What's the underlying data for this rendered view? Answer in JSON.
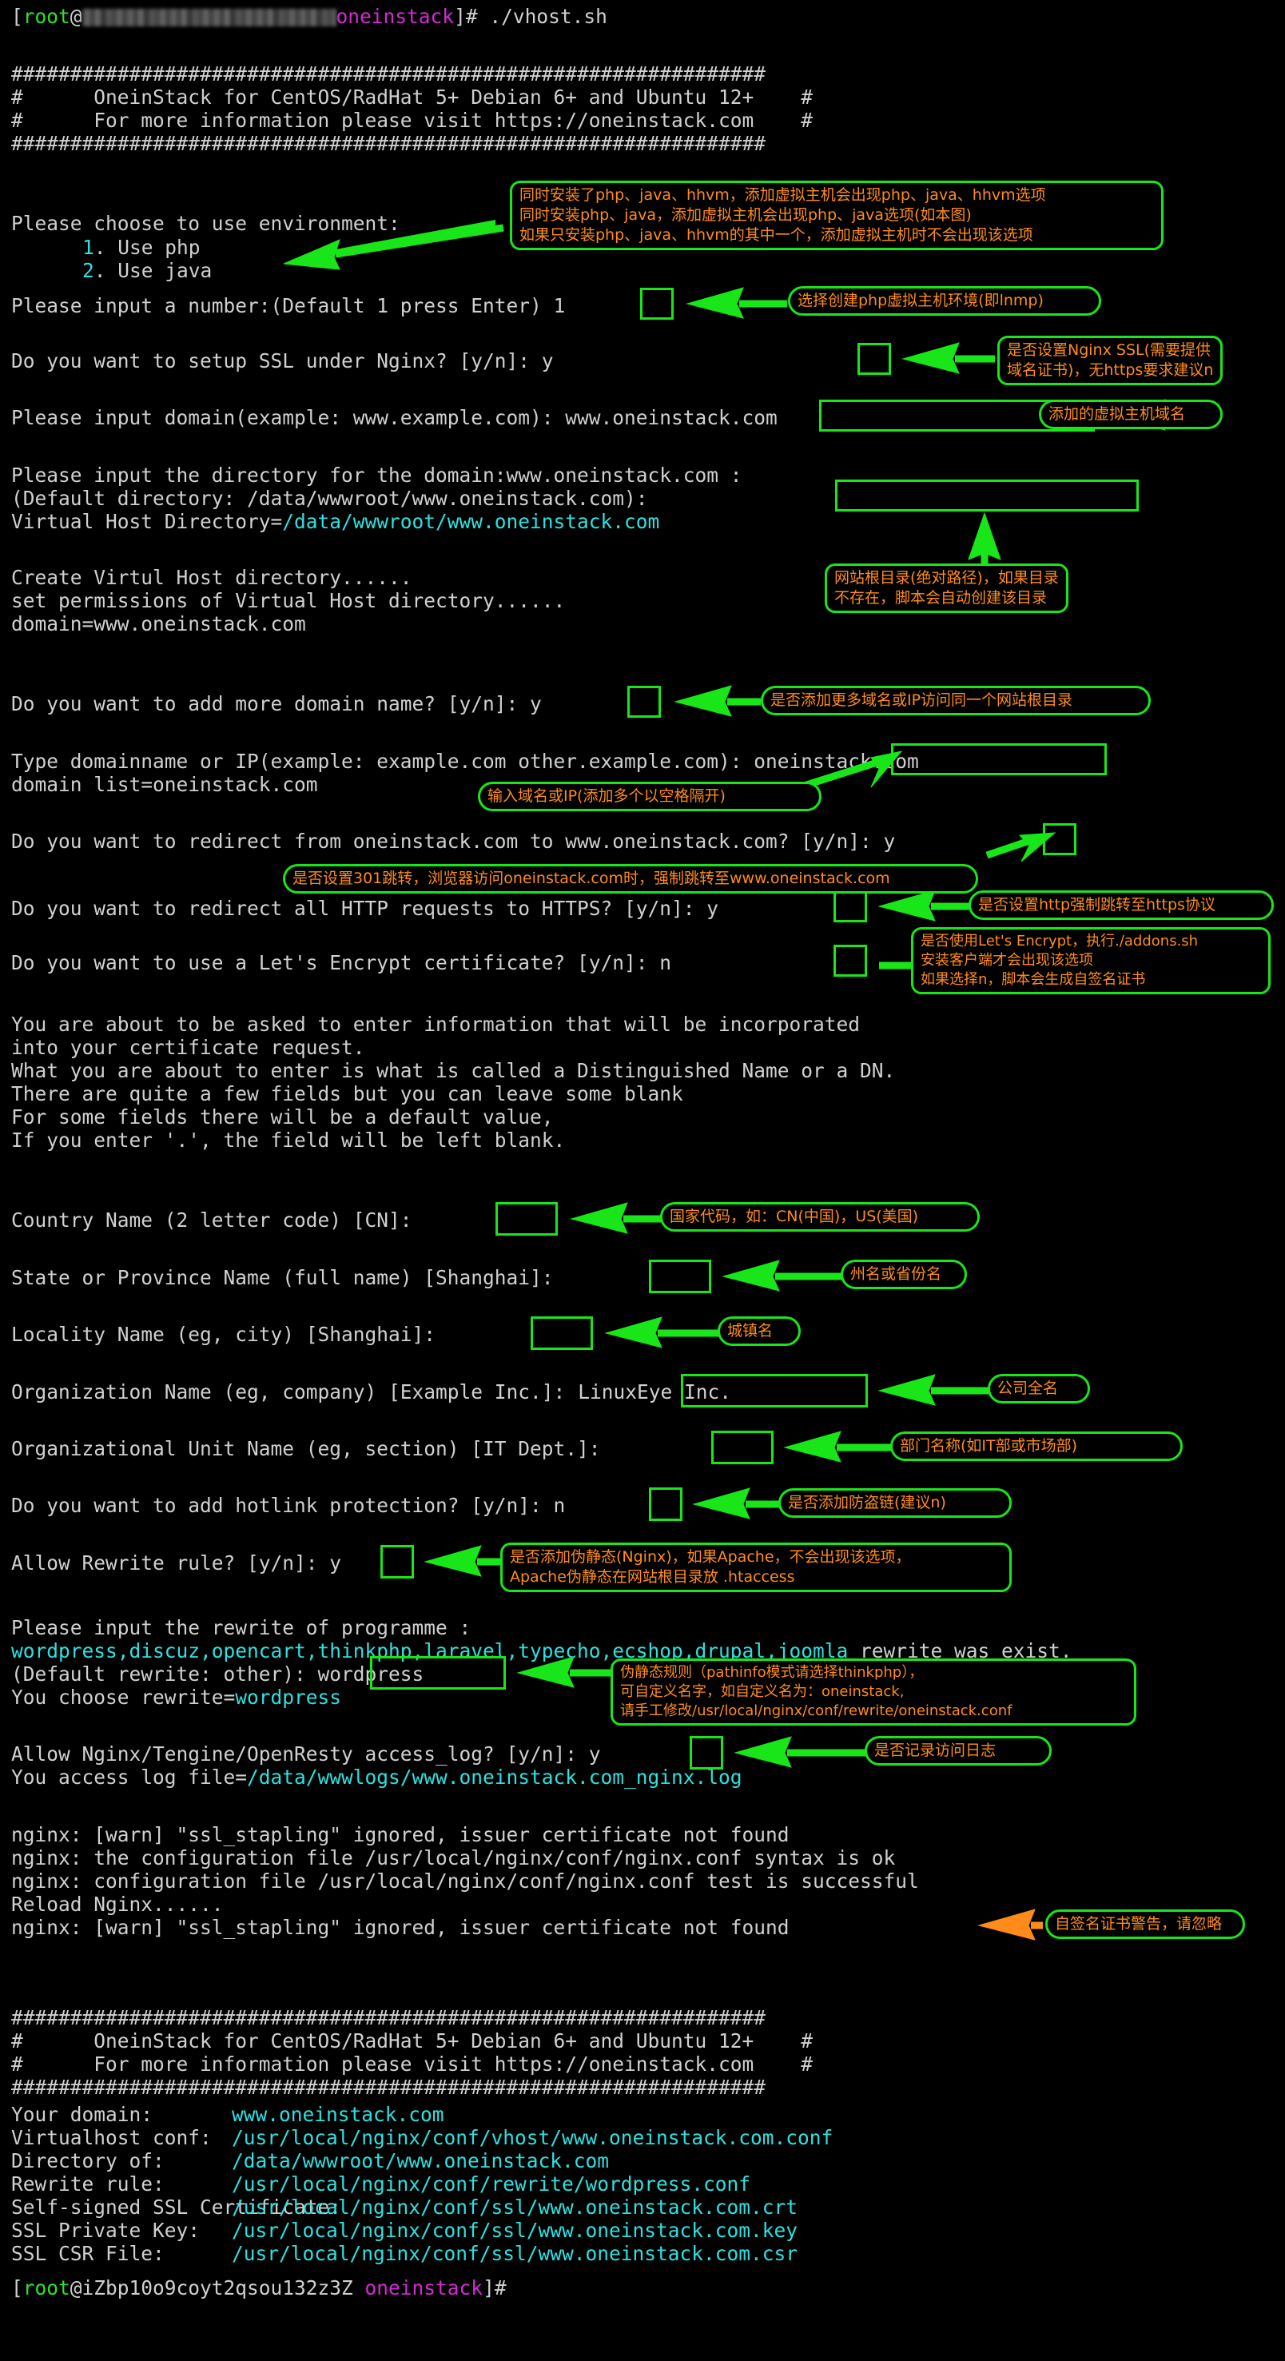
{
  "terminal": {
    "prompt_top": {
      "bracket_open": "[",
      "user": "root",
      "at": "@",
      "host_redacted": true,
      "dir": "oneinstack",
      "bracket_close": "]# ",
      "command": "./vhost.sh"
    },
    "prompt_bottom": {
      "bracket_open": "[",
      "user": "root",
      "at": "@iZbp10o9coyt2qsou132z3Z ",
      "dir": "oneinstack",
      "bracket_close": "]#"
    },
    "banner": {
      "rule": "################################################################",
      "line1": "#      OneinStack for CentOS/RadHat 5+ Debian 6+ and Ubuntu 12+    #",
      "line2": "#      For more information please visit https://oneinstack.com    #"
    },
    "lines": {
      "choose_env": "Please choose to use environment:",
      "opt1_num": "1",
      "opt1_label": ". Use php",
      "opt2_num": "2",
      "opt2_label": ". Use java",
      "input_number": "Please input a number:(Default 1 press Enter) ",
      "input_number_value": "1",
      "ssl_q": "Do you want to setup SSL under Nginx? [y/n]: ",
      "ssl_value": "y",
      "domain_q": "Please input domain(example: www.example.com): ",
      "domain_value": "www.oneinstack.com",
      "dir_q": "Please input the directory for the domain:www.oneinstack.com :",
      "dir_default": "(Default directory: /data/wwwroot/www.oneinstack.com): ",
      "vhost_dir_label": "Virtual Host Directory=",
      "vhost_dir_value": "/data/wwwroot/www.oneinstack.com",
      "create_dir": "Create Virtul Host directory......",
      "set_perm": "set permissions of Virtual Host directory......",
      "domain_eq": "domain=www.oneinstack.com",
      "more_domain_q": "Do you want to add more domain name? [y/n]: ",
      "more_domain_value": "y",
      "type_domain": "Type domainname or IP(example: example.com other.example.com): ",
      "type_domain_value": "oneinstack.com",
      "domain_list": "domain list=oneinstack.com",
      "redirect_q": "Do you want to redirect from oneinstack.com to www.oneinstack.com? [y/n]: ",
      "redirect_value": "y",
      "https_q": "Do you want to redirect all HTTP requests to HTTPS? [y/n]: ",
      "https_value": "y",
      "letsencrypt_q": "Do you want to use a Let's Encrypt certificate? [y/n]: ",
      "letsencrypt_value": "n",
      "dn1": "You are about to be asked to enter information that will be incorporated",
      "dn2": "into your certificate request.",
      "dn3": "What you are about to enter is what is called a Distinguished Name or a DN.",
      "dn4": "There are quite a few fields but you can leave some blank",
      "dn5": "For some fields there will be a default value,",
      "dn6": "If you enter '.', the field will be left blank.",
      "country": "Country Name (2 letter code) [CN]:",
      "country_value": "",
      "state": "State or Province Name (full name) [Shanghai]:",
      "state_value": "",
      "locality": "Locality Name (eg, city) [Shanghai]:",
      "locality_value": "",
      "org": "Organization Name (eg, company) [Example Inc.]:",
      "org_value": "LinuxEye Inc.",
      "ou": "Organizational Unit Name (eg, section) [IT Dept.]:",
      "ou_value": "",
      "hotlink_q": "Do you want to add hotlink protection? [y/n]: ",
      "hotlink_value": "n",
      "rewrite_q": "Allow Rewrite rule? [y/n]: ",
      "rewrite_value": "y",
      "rewrite_prompt": "Please input the rewrite of programme :",
      "rewrite_list": "wordpress,discuz,opencart,thinkphp,laravel,typecho,ecshop,drupal,joomla",
      "rewrite_tail": " rewrite was exist.",
      "rewrite_default": "(Default rewrite: other): ",
      "rewrite_default_value": "wordpress",
      "rewrite_choose": "You choose rewrite=",
      "rewrite_choose_value": "wordpress",
      "accesslog_q": "Allow Nginx/Tengine/OpenResty access_log? [y/n]: ",
      "accesslog_value": "y",
      "accesslog_file_label": "You access log file=",
      "accesslog_file_value": "/data/wwwlogs/www.oneinstack.com_nginx.log",
      "nginx1": "nginx: [warn] \"ssl_stapling\" ignored, issuer certificate not found",
      "nginx2": "nginx: the configuration file /usr/local/nginx/conf/nginx.conf syntax is ok",
      "nginx3": "nginx: configuration file /usr/local/nginx/conf/nginx.conf test is successful",
      "nginx4": "Reload Nginx......",
      "nginx5": "nginx: [warn] \"ssl_stapling\" ignored, issuer certificate not found"
    },
    "summary": [
      {
        "label": "Your domain:",
        "value": "www.oneinstack.com"
      },
      {
        "label": "Virtualhost conf:",
        "value": "/usr/local/nginx/conf/vhost/www.oneinstack.com.conf"
      },
      {
        "label": "Directory of:",
        "value": "/data/wwwroot/www.oneinstack.com"
      },
      {
        "label": "Rewrite rule:",
        "value": "/usr/local/nginx/conf/rewrite/wordpress.conf"
      },
      {
        "label": "Self-signed SSL Certificate:",
        "value": "/usr/local/nginx/conf/ssl/www.oneinstack.com.crt"
      },
      {
        "label": "SSL Private Key:",
        "value": "/usr/local/nginx/conf/ssl/www.oneinstack.com.key"
      },
      {
        "label": "SSL CSR File:",
        "value": "/usr/local/nginx/conf/ssl/www.oneinstack.com.csr"
      }
    ]
  },
  "annotations": {
    "env_options": "同时安装了php、java、hhvm，添加虚拟主机会出现php、java、hhvm选项\n同时安装php、java，添加虚拟主机会出现php、java选项(如本图)\n如果只安装php、java、hhvm的其中一个，添加虚拟主机时不会出现该选项",
    "choose_lnmp": "选择创建php虚拟主机环境(即lnmp)",
    "nginx_ssl": "是否设置Nginx SSL(需要提供\n域名证书)，无https要求建议n",
    "add_domain": "添加的虚拟主机域名",
    "web_root": "网站根目录(绝对路径)，如果目录\n不存在，脚本会自动创建该目录",
    "more_domains": "是否添加更多域名或IP访问同一个网站根目录",
    "input_domain_ip": "输入域名或IP(添加多个以空格隔开)",
    "redirect_301": "是否设置301跳转，浏览器访问oneinstack.com时，强制跳转至www.oneinstack.com",
    "force_https": "是否设置http强制跳转至https协议",
    "lets_encrypt": "是否使用Let's Encrypt，执行./addons.sh\n安装客户端才会出现该选项\n如果选择n，脚本会生成自签名证书",
    "country_code": "国家代码，如：CN(中国)，US(美国)",
    "state_name": "州名或省份名",
    "city_name": "城镇名",
    "company_name": "公司全名",
    "dept_name": "部门名称(如IT部或市场部)",
    "hotlink": "是否添加防盗链(建议n)",
    "rewrite_rule": "是否添加伪静态(Nginx)，如果Apache，不会出现该选项，\nApache伪静态在网站根目录放 .htaccess",
    "rewrite_detail": "伪静态规则（pathinfo模式请选择thinkphp），\n可自定义名字，如自定义名为：oneinstack,\n请手工修改/usr/local/nginx/conf/rewrite/oneinstack.conf",
    "access_log": "是否记录访问日志",
    "selfsigned_warn": "自签名证书警告，请忽略"
  },
  "colors": {
    "green": "#19e619",
    "orange": "#ff8c1a",
    "cyan": "#2ee0e0",
    "magenta": "#d42ad4",
    "prompt_green": "#2ee02e",
    "arrow_orange": "#ff8c1a"
  }
}
